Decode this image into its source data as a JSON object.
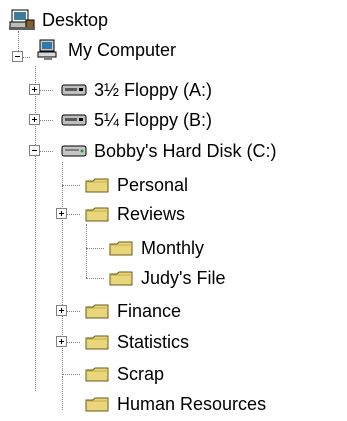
{
  "tree": {
    "root": {
      "label": "Desktop",
      "icon": "desktop-icon"
    },
    "my_computer": {
      "label": "My Computer",
      "icon": "computer-icon"
    },
    "floppy_a": {
      "label": "3½ Floppy (A:)",
      "icon": "floppy-drive-icon"
    },
    "floppy_b": {
      "label": "5¼ Floppy (B:)",
      "icon": "floppy-drive-icon"
    },
    "hard_disk": {
      "label": "Bobby's Hard Disk (C:)",
      "icon": "hard-disk-icon"
    },
    "personal": {
      "label": "Personal",
      "icon": "folder-icon"
    },
    "reviews": {
      "label": "Reviews",
      "icon": "folder-icon"
    },
    "monthly": {
      "label": "Monthly",
      "icon": "folder-icon"
    },
    "judys_file": {
      "label": "Judy's File",
      "icon": "folder-icon"
    },
    "finance": {
      "label": "Finance",
      "icon": "folder-icon"
    },
    "statistics": {
      "label": "Statistics",
      "icon": "folder-icon"
    },
    "scrap": {
      "label": "Scrap",
      "icon": "folder-icon"
    },
    "human_resources": {
      "label": "Human Resources",
      "icon": "folder-icon"
    }
  },
  "colors": {
    "folder_fill": "#e9d67a",
    "folder_edge": "#6b5a1e",
    "tree_line": "#808080"
  }
}
